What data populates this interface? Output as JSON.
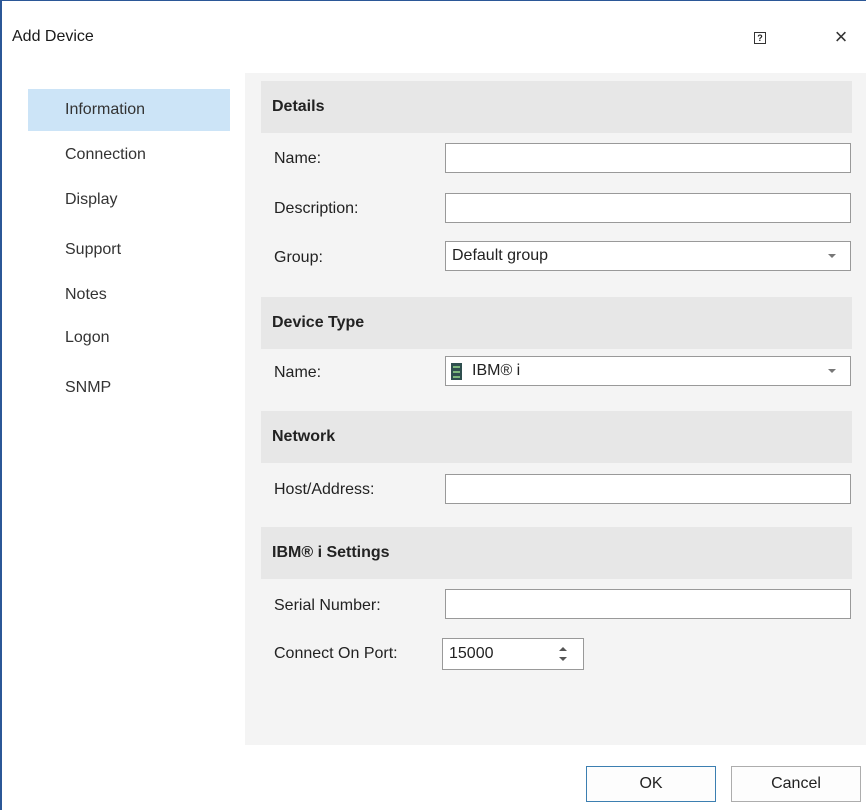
{
  "window": {
    "title": "Add Device",
    "help_label": "?",
    "close_label": "×"
  },
  "sidebar": {
    "items": [
      {
        "label": "Information"
      },
      {
        "label": "Connection"
      },
      {
        "label": "Display"
      },
      {
        "label": "Support"
      },
      {
        "label": "Notes"
      },
      {
        "label": "Logon"
      },
      {
        "label": "SNMP"
      }
    ],
    "active": "Information"
  },
  "details": {
    "header": "Details",
    "name_label": "Name:",
    "name_value": "",
    "description_label": "Description:",
    "description_value": "",
    "group_label": "Group:",
    "group_value": "Default group"
  },
  "device_type": {
    "header": "Device Type",
    "name_label": "Name:",
    "name_value": "IBM® i"
  },
  "network": {
    "header": "Network",
    "host_label": "Host/Address:",
    "host_value": ""
  },
  "ibm_settings": {
    "header": "IBM® i Settings",
    "serial_label": "Serial Number:",
    "serial_value": "",
    "port_label": "Connect On Port:",
    "port_value": "15000"
  },
  "footer": {
    "ok_label": "OK",
    "cancel_label": "Cancel"
  },
  "colors": {
    "accent_border": "#2b5797",
    "active_nav": "#cce4f7",
    "ok_border": "#3c7fb1"
  }
}
